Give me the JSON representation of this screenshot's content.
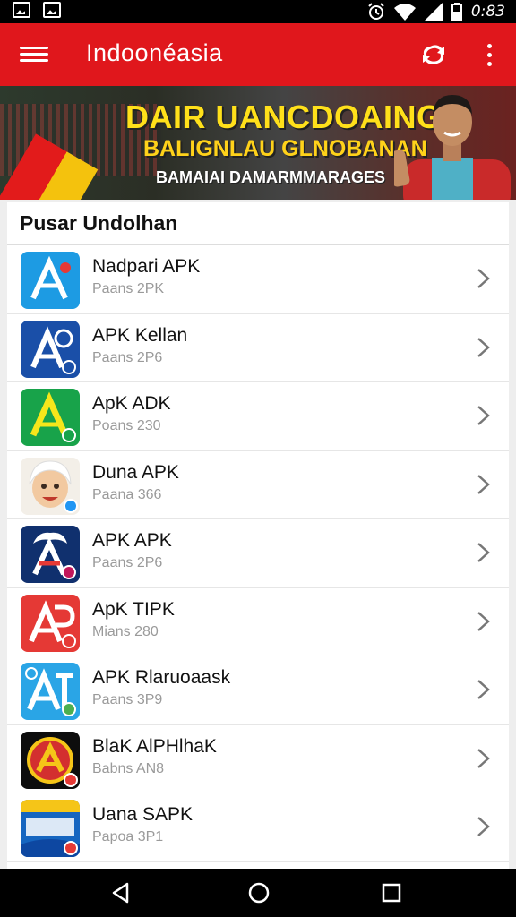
{
  "status_bar": {
    "time": "0:83",
    "icons": [
      "image-icon",
      "gallery-icon",
      "alarm-icon",
      "wifi-icon",
      "signal-icon",
      "battery-icon"
    ]
  },
  "app_bar": {
    "title": "Indoonéasia",
    "icons": [
      "menu-icon",
      "sync-icon",
      "more-vert-icon"
    ],
    "color": "#e0171c"
  },
  "banner": {
    "line1": "DAIR UANCDOAING",
    "line2": "BALIGNLAU GLNOBANAN",
    "line3": "BAMAIAI DAMARMMARAGES"
  },
  "section": {
    "title": "Pusar Undolhan"
  },
  "items": [
    {
      "name": "Nadpari APK",
      "sub": "Paans 2PK",
      "icon": "a-icon-blue"
    },
    {
      "name": "APK Kellan",
      "sub": "Paans 2P6",
      "icon": "a-icon-navy"
    },
    {
      "name": "ApK ADK",
      "sub": "Poans 230",
      "icon": "a-icon-green"
    },
    {
      "name": "Duna APK",
      "sub": "Paana 366",
      "icon": "avatar-icon"
    },
    {
      "name": "APK APK",
      "sub": "Paans 2P6",
      "icon": "a-icon-darkblue"
    },
    {
      "name": "ApK TIPK",
      "sub": "Mians 280",
      "icon": "a-icon-red"
    },
    {
      "name": "APK Rlaruoaask",
      "sub": "Paans 3P9",
      "icon": "a-icon-lightblue"
    },
    {
      "name": "BlaK AlPHlhaK",
      "sub": "Babns AN8",
      "icon": "a-icon-black"
    },
    {
      "name": "Uana SAPK",
      "sub": "Papoa 3P1",
      "icon": "banner-icon"
    }
  ],
  "nav_bar": {
    "icons": [
      "back-icon",
      "home-icon",
      "recent-apps-icon"
    ]
  }
}
